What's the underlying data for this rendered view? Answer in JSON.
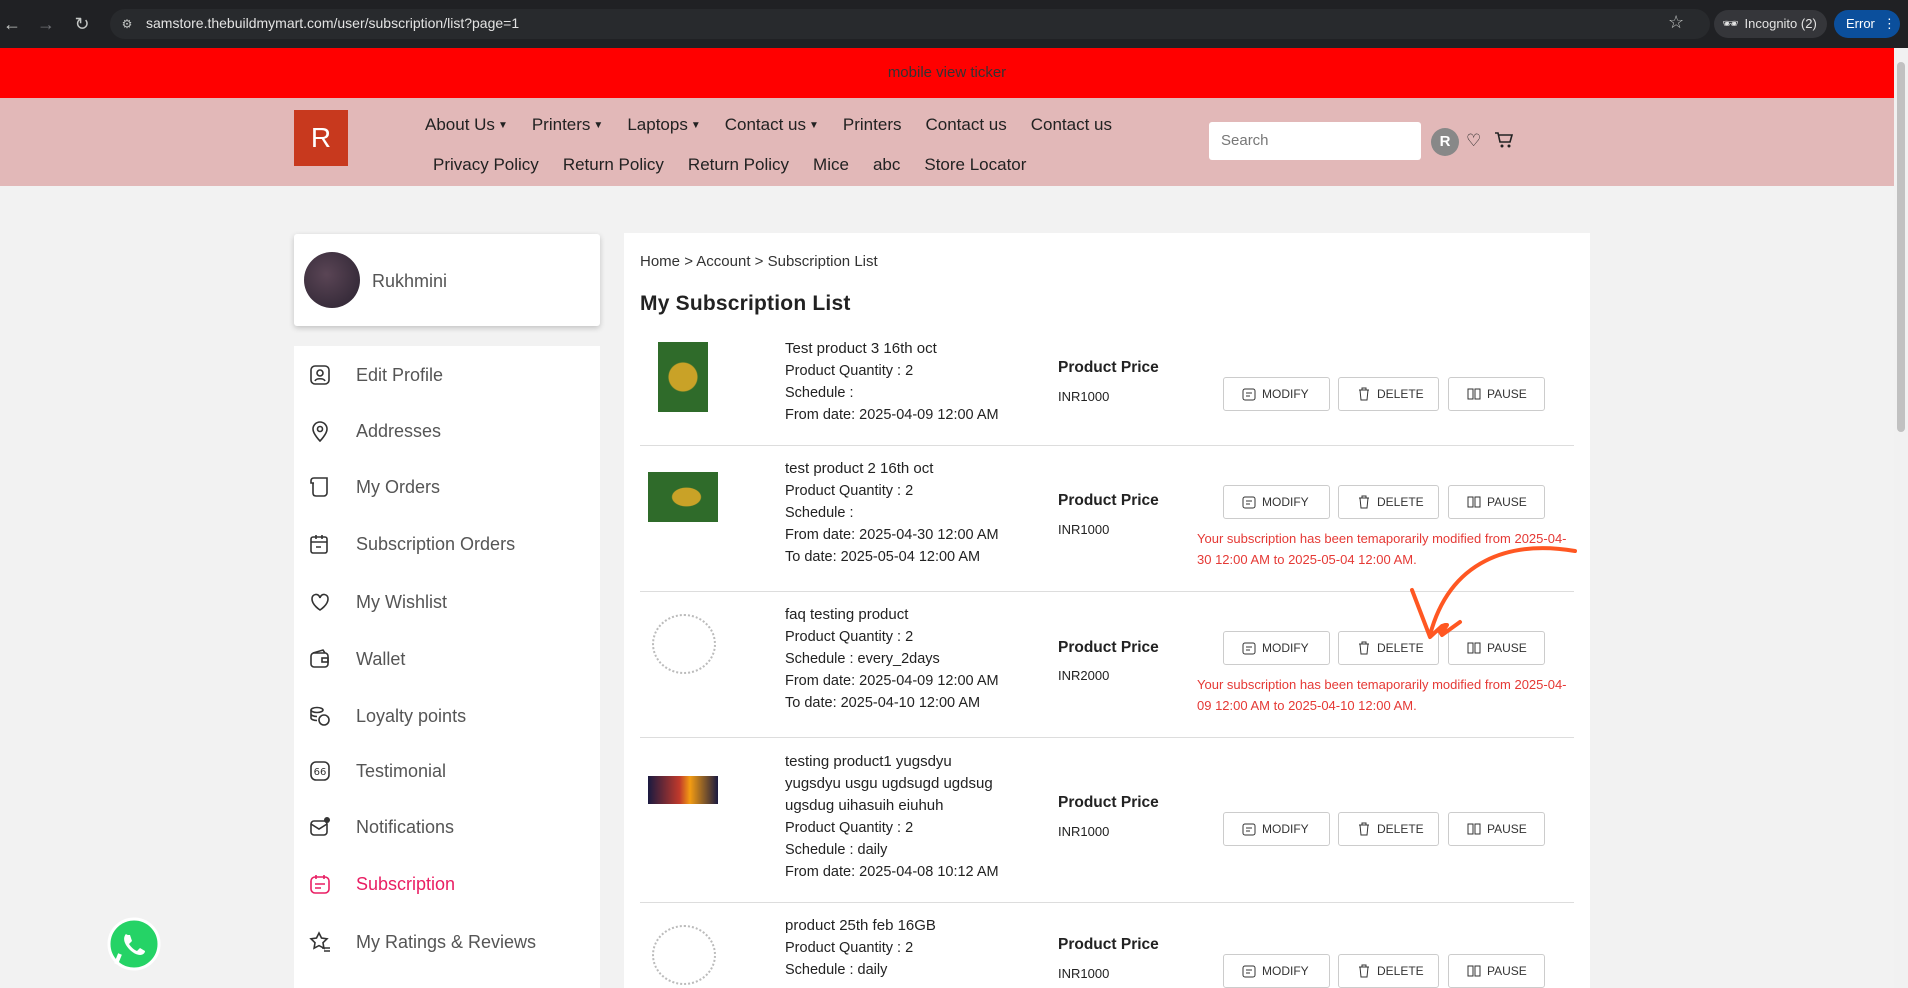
{
  "browser": {
    "url": "samstore.thebuildmymart.com/user/subscription/list?page=1",
    "incognito_label": "Incognito (2)",
    "error_label": "Error"
  },
  "ticker": {
    "text": "mobile view ticker"
  },
  "header": {
    "logo_letter": "R",
    "menu_row1": [
      "About Us",
      "Printers",
      "Laptops",
      "Contact us",
      "Printers",
      "Contact us",
      "Contact us"
    ],
    "menu_row2": [
      "Privacy Policy",
      "Return Policy",
      "Return Policy",
      "Mice",
      "abc",
      "Store Locator"
    ],
    "search_placeholder": "Search",
    "user_initial": "R"
  },
  "profile": {
    "name": "Rukhmini"
  },
  "sidebar": {
    "items": [
      {
        "label": "Edit Profile",
        "icon": "user-icon"
      },
      {
        "label": "Addresses",
        "icon": "location-pin-icon"
      },
      {
        "label": "My Orders",
        "icon": "receipt-icon"
      },
      {
        "label": "Subscription Orders",
        "icon": "calendar-edit-icon"
      },
      {
        "label": "My Wishlist",
        "icon": "heart-icon"
      },
      {
        "label": "Wallet",
        "icon": "wallet-icon"
      },
      {
        "label": "Loyalty points",
        "icon": "coins-icon"
      },
      {
        "label": "Testimonial",
        "icon": "quote-icon"
      },
      {
        "label": "Notifications",
        "icon": "mail-notification-icon"
      },
      {
        "label": "Subscription",
        "icon": "subscription-icon"
      },
      {
        "label": "My Ratings & Reviews",
        "icon": "star-rating-icon"
      }
    ],
    "active_index": 9,
    "active_color": "#e91e63"
  },
  "breadcrumb": {
    "home": "Home",
    "sep": ">",
    "account": "Account",
    "current": "Subscription List"
  },
  "page_title": "My Subscription List",
  "price_label": "Product Price",
  "buttons": {
    "modify": "MODIFY",
    "delete": "DELETE",
    "pause": "PAUSE"
  },
  "subscriptions": [
    {
      "name": "Test product 3 16th oct",
      "quantity": "Product Quantity : 2",
      "schedule": "Schedule :",
      "from": "From date: 2025-04-09 12:00 AM",
      "to": "",
      "price": "INR1000",
      "notice": ""
    },
    {
      "name": "test product 2 16th oct",
      "quantity": "Product Quantity : 2",
      "schedule": "Schedule :",
      "from": "From date: 2025-04-30 12:00 AM",
      "to": "To date: 2025-05-04 12:00 AM",
      "price": "INR1000",
      "notice": "Your subscription has been temaporarily modified from 2025-04-30 12:00 AM to 2025-05-04 12:00 AM."
    },
    {
      "name": "faq testing product",
      "quantity": "Product Quantity : 2",
      "schedule": "Schedule : every_2days",
      "from": "From date: 2025-04-09 12:00 AM",
      "to": "To date: 2025-04-10 12:00 AM",
      "price": "INR2000",
      "notice": "Your subscription has been temaporarily modified from 2025-04-09 12:00 AM to 2025-04-10 12:00 AM."
    },
    {
      "name": "testing product1 yugsdyu yugsdyu usgu ugdsugd ugdsug ugsdug uihasuih eiuhuh",
      "quantity": "Product Quantity : 2",
      "schedule": "Schedule : daily",
      "from": "From date: 2025-04-08 10:12 AM",
      "to": "",
      "price": "INR1000",
      "notice": ""
    },
    {
      "name": "product 25th feb 16GB",
      "quantity": "Product Quantity : 2",
      "schedule": "Schedule : daily",
      "from": "",
      "to": "",
      "price": "INR1000",
      "notice": ""
    }
  ],
  "colors": {
    "ticker": "#ff0000",
    "header": "#e2b8b8",
    "logo": "#c8391e",
    "notice": "#e53935",
    "annotation_arrow": "#ff5722"
  }
}
